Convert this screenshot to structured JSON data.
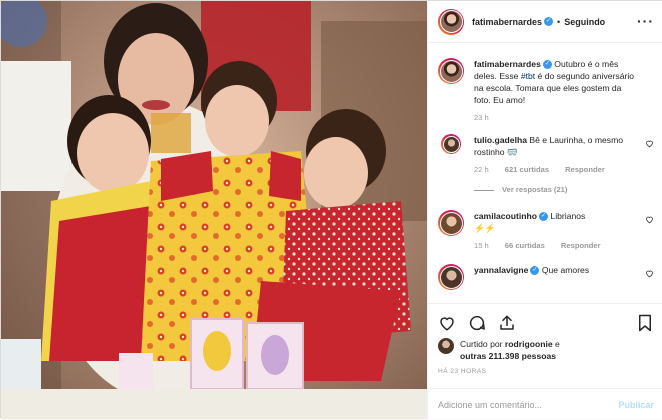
{
  "post": {
    "author": "fatimabernardes",
    "follow_status": "Seguindo",
    "more_icon": "more-options-icon",
    "photo_alt": "Foto de família: mulher com três crianças"
  },
  "caption": {
    "user": "fatimabernardes",
    "text_before": " Outubro é o mês deles. Esse ",
    "hashtag": "#tbt",
    "text_after": " é do segundo aniversário na escola. Tomara que eles gostem da foto. Eu amo!",
    "time": "23 h"
  },
  "comments": [
    {
      "user": "tulio.gadelha",
      "text": "Bê e Laurinha, o mesmo rostinho 🥽",
      "time": "22 h",
      "likes": "621 curtidas",
      "reply": "Responder",
      "replies": "Ver respostas (21)"
    },
    {
      "user": "camilacoutinho",
      "text": "Librianos",
      "second_line": "⚡⚡",
      "time": "15 h",
      "likes": "66 curtidas",
      "reply": "Responder"
    },
    {
      "user": "yannalavigne",
      "text": "Que amores",
      "time": ""
    }
  ],
  "liked_by": {
    "prefix": "Curtido por ",
    "user": "rodrigoonie",
    "middle": " e",
    "line2_prefix": "outras ",
    "count": "211.398 pessoas"
  },
  "posted_time": "HÁ 23 HORAS",
  "add_comment": {
    "placeholder": "Adicione um comentário...",
    "publish": "Publicar"
  },
  "colors": {
    "verified": "#3897f0",
    "link": "#003569",
    "muted": "#999999",
    "publish_disabled": "#b2dffc"
  }
}
